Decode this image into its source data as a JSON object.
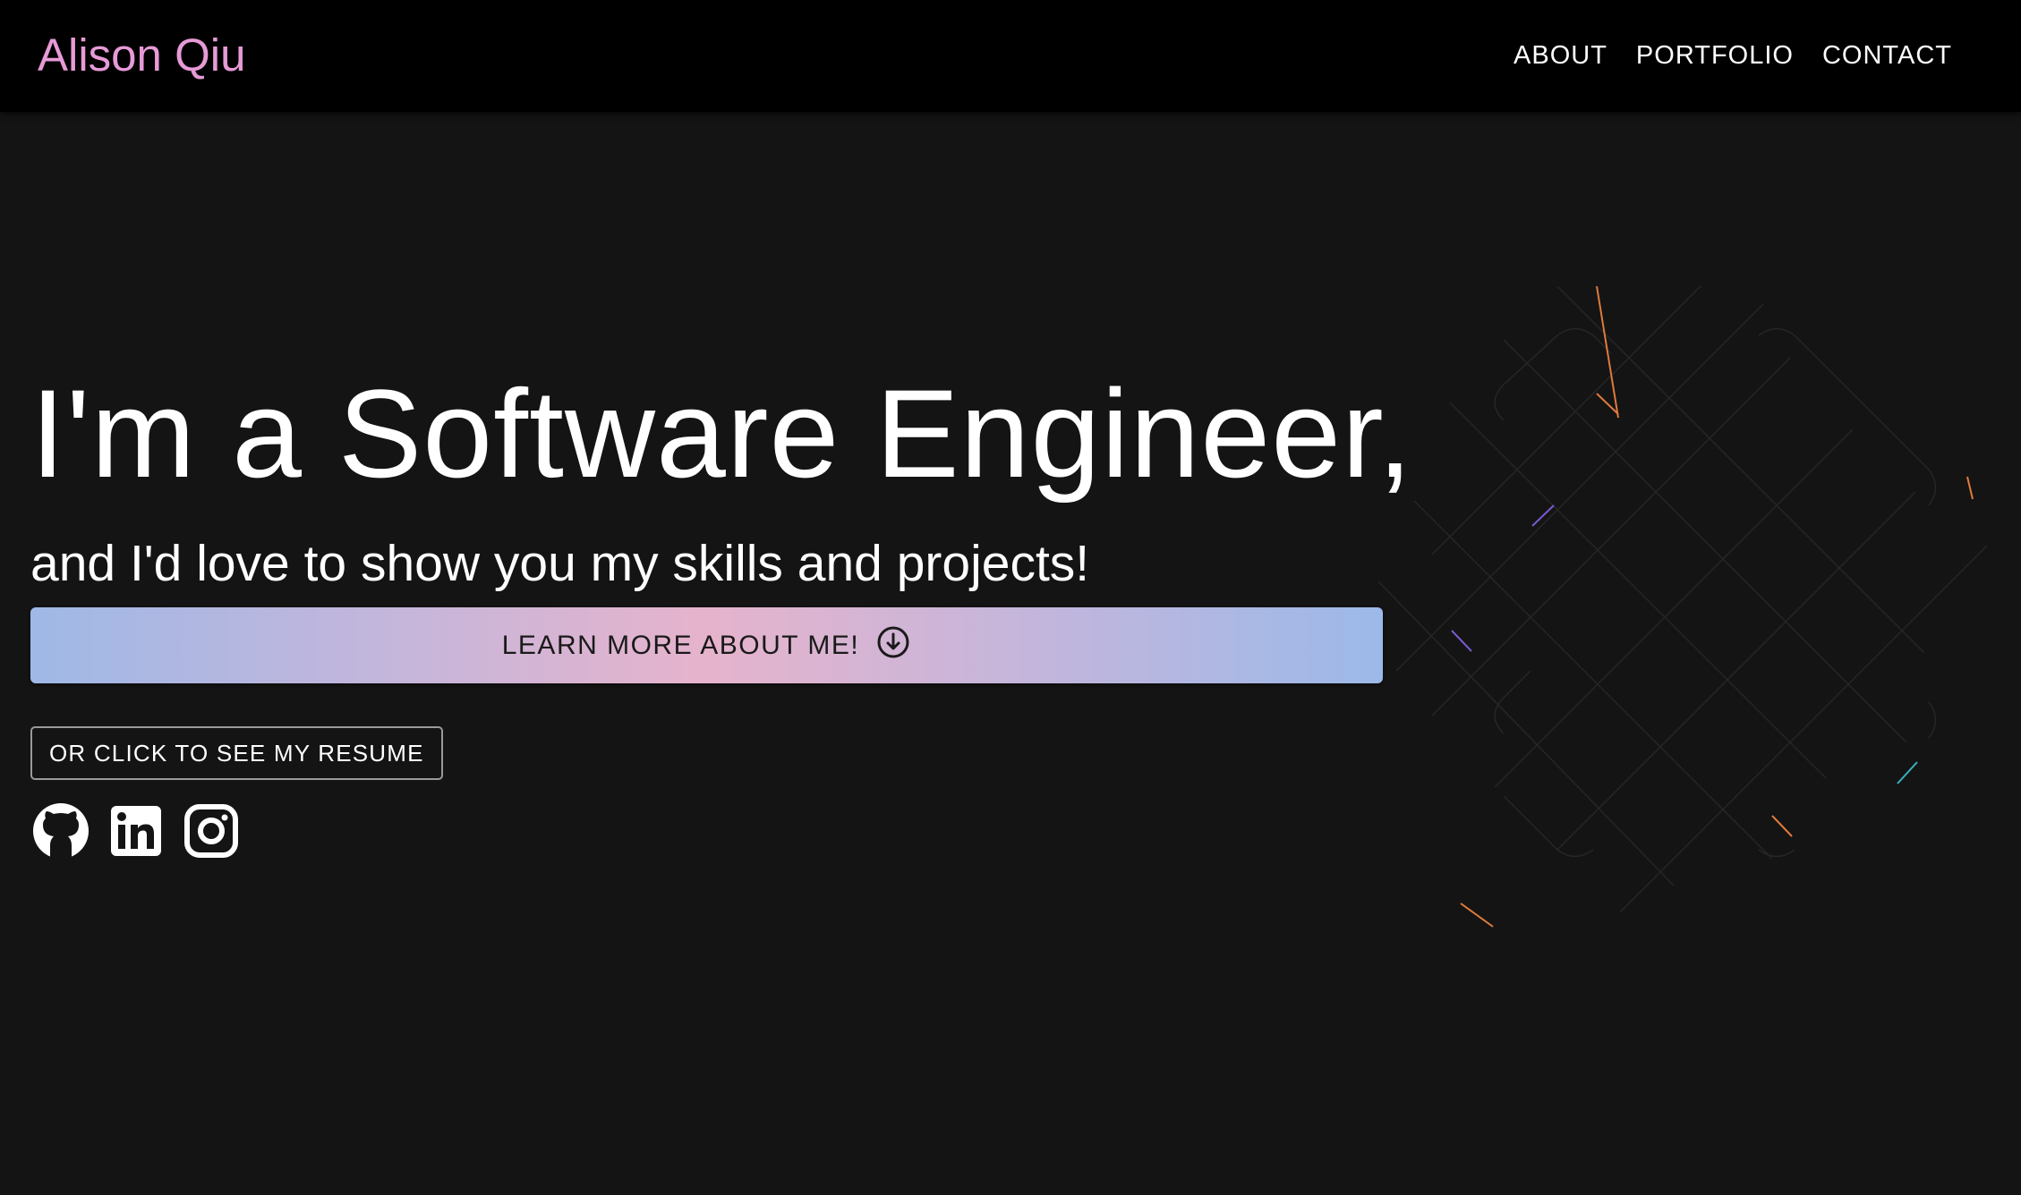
{
  "nav": {
    "brand": "Alison Qiu",
    "links": [
      "ABOUT",
      "PORTFOLIO",
      "CONTACT"
    ]
  },
  "hero": {
    "title": "I'm a Software Engineer,",
    "subtitle": "and I'd love to show you my skills and projects!",
    "learn_button": "LEARN MORE ABOUT ME!",
    "learn_icon": "arrow-down-circle-icon",
    "resume_button": "OR CLICK TO SEE MY RESUME"
  },
  "socials": [
    {
      "name": "GitHub",
      "icon": "github-icon"
    },
    {
      "name": "LinkedIn",
      "icon": "linkedin-icon"
    },
    {
      "name": "Instagram",
      "icon": "instagram-icon"
    }
  ],
  "colors": {
    "background": "#141414",
    "navbar": "#000000",
    "brand": "#e69ad6",
    "gradient_blue": "#9fb8e6",
    "gradient_pink": "#e6b3cc",
    "text": "#ffffff"
  }
}
